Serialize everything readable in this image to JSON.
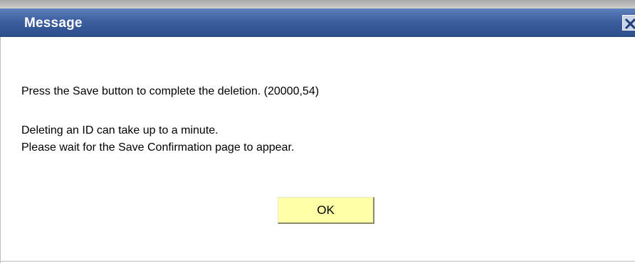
{
  "dialog": {
    "title": "Message",
    "close_icon": "close-icon",
    "message_line_1": "Press the Save button to complete the deletion. (20000,54)",
    "message_line_2": "Deleting an ID can take up to a minute.",
    "message_line_3": "Please wait for the Save Confirmation page to appear.",
    "ok_label": "OK"
  },
  "colors": {
    "titlebar": "#3d5f9f",
    "title_text": "#ffffff",
    "ok_button": "#ffffa8"
  }
}
